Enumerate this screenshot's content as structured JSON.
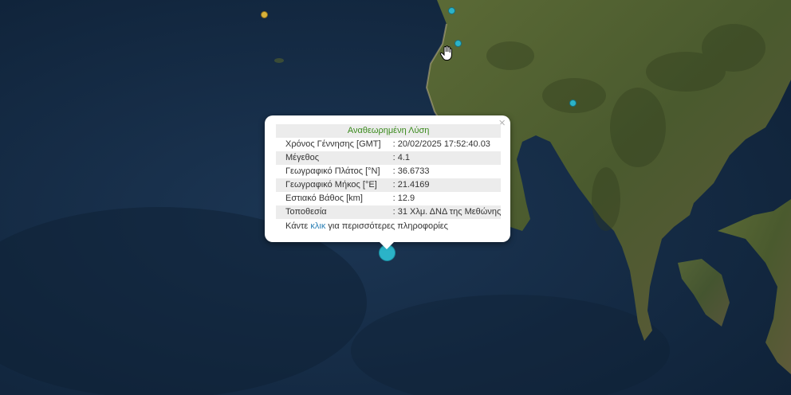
{
  "popup": {
    "header": "Αναθεωρημένη Λύση",
    "close_glyph": "×",
    "rows": [
      {
        "label": "Χρόνος Γέννησης [GMT]",
        "value": ": 20/02/2025 17:52:40.03"
      },
      {
        "label": "Μέγεθος",
        "value": ": 4.1"
      },
      {
        "label": "Γεωγραφικό Πλάτος [°N]",
        "value": ": 36.6733"
      },
      {
        "label": "Γεωγραφικό Μήκος [°E]",
        "value": ": 21.4169"
      },
      {
        "label": "Εστιακό Βάθος [km]",
        "value": ": 12.9"
      },
      {
        "label": "Τοποθεσία",
        "value": ": 31 Χλμ. ΔΝΔ της Μεθώνης"
      }
    ],
    "more_prefix": "Κάντε ",
    "more_link": "κλικ",
    "more_suffix": " για περισσότερες πληροφορίες"
  },
  "colors": {
    "sea": "#132a44",
    "land": "#4a5a30",
    "marker_cyan": "#2bb3c8",
    "marker_yellow": "#d8b23a",
    "header_green": "#3a8a1c",
    "link": "#2a7fb5"
  },
  "cursor_icon": "hand-pointer-icon"
}
